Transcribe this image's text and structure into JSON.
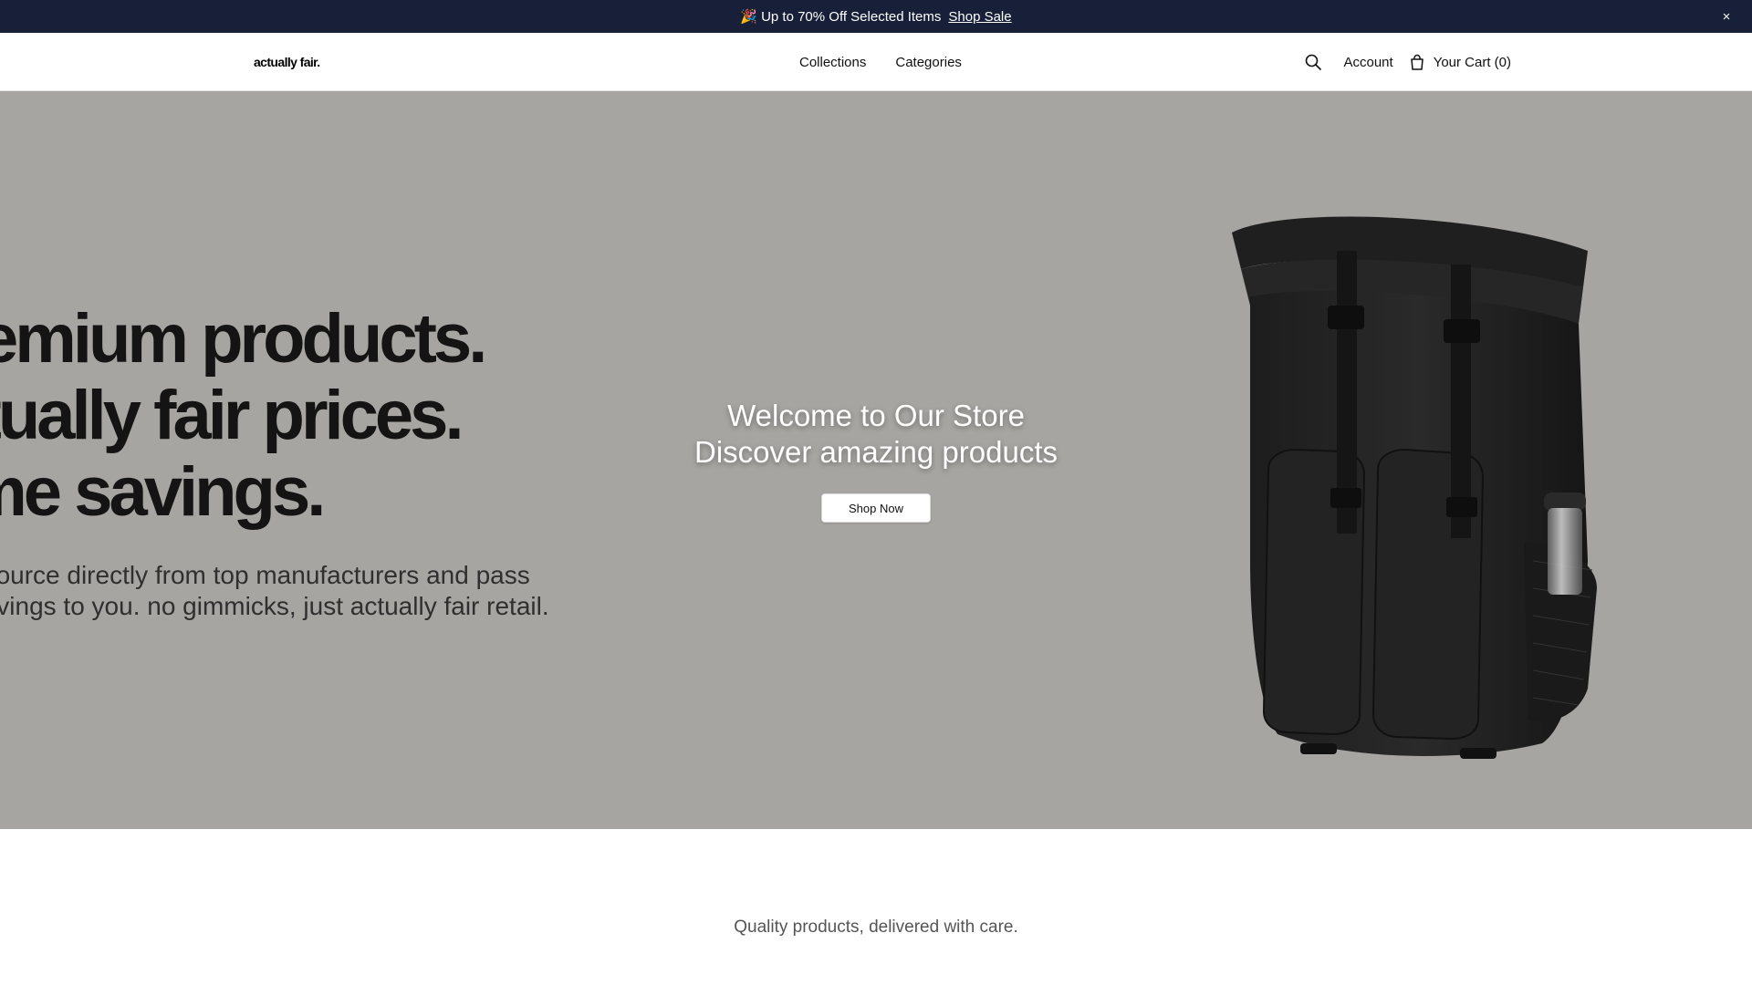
{
  "announcement": {
    "emoji": "🎉",
    "text": "Up to 70% Off Selected Items",
    "link_label": "Shop Sale",
    "close_label": "×"
  },
  "header": {
    "logo": "actually fair.",
    "nav": [
      "Collections",
      "Categories"
    ],
    "account_label": "Account",
    "cart_label": "Your Cart (0)"
  },
  "hero": {
    "headline_lines": [
      "premium products.",
      "actually fair prices.",
      "lifetime savings."
    ],
    "subtext_lines": [
      "we source directly from top manufacturers and pass",
      "the savings to you. no gimmicks, just actually fair retail."
    ],
    "title": "Welcome to Our Store",
    "subtitle": "Discover amazing products",
    "cta_label": "Shop Now"
  },
  "tagline": "Quality products, delivered with care.",
  "colors": {
    "announcement_bg": "#172038",
    "hero_bg": "#a7a5a1"
  },
  "icons": [
    "close-icon",
    "search-icon",
    "shopping-bag-icon"
  ]
}
